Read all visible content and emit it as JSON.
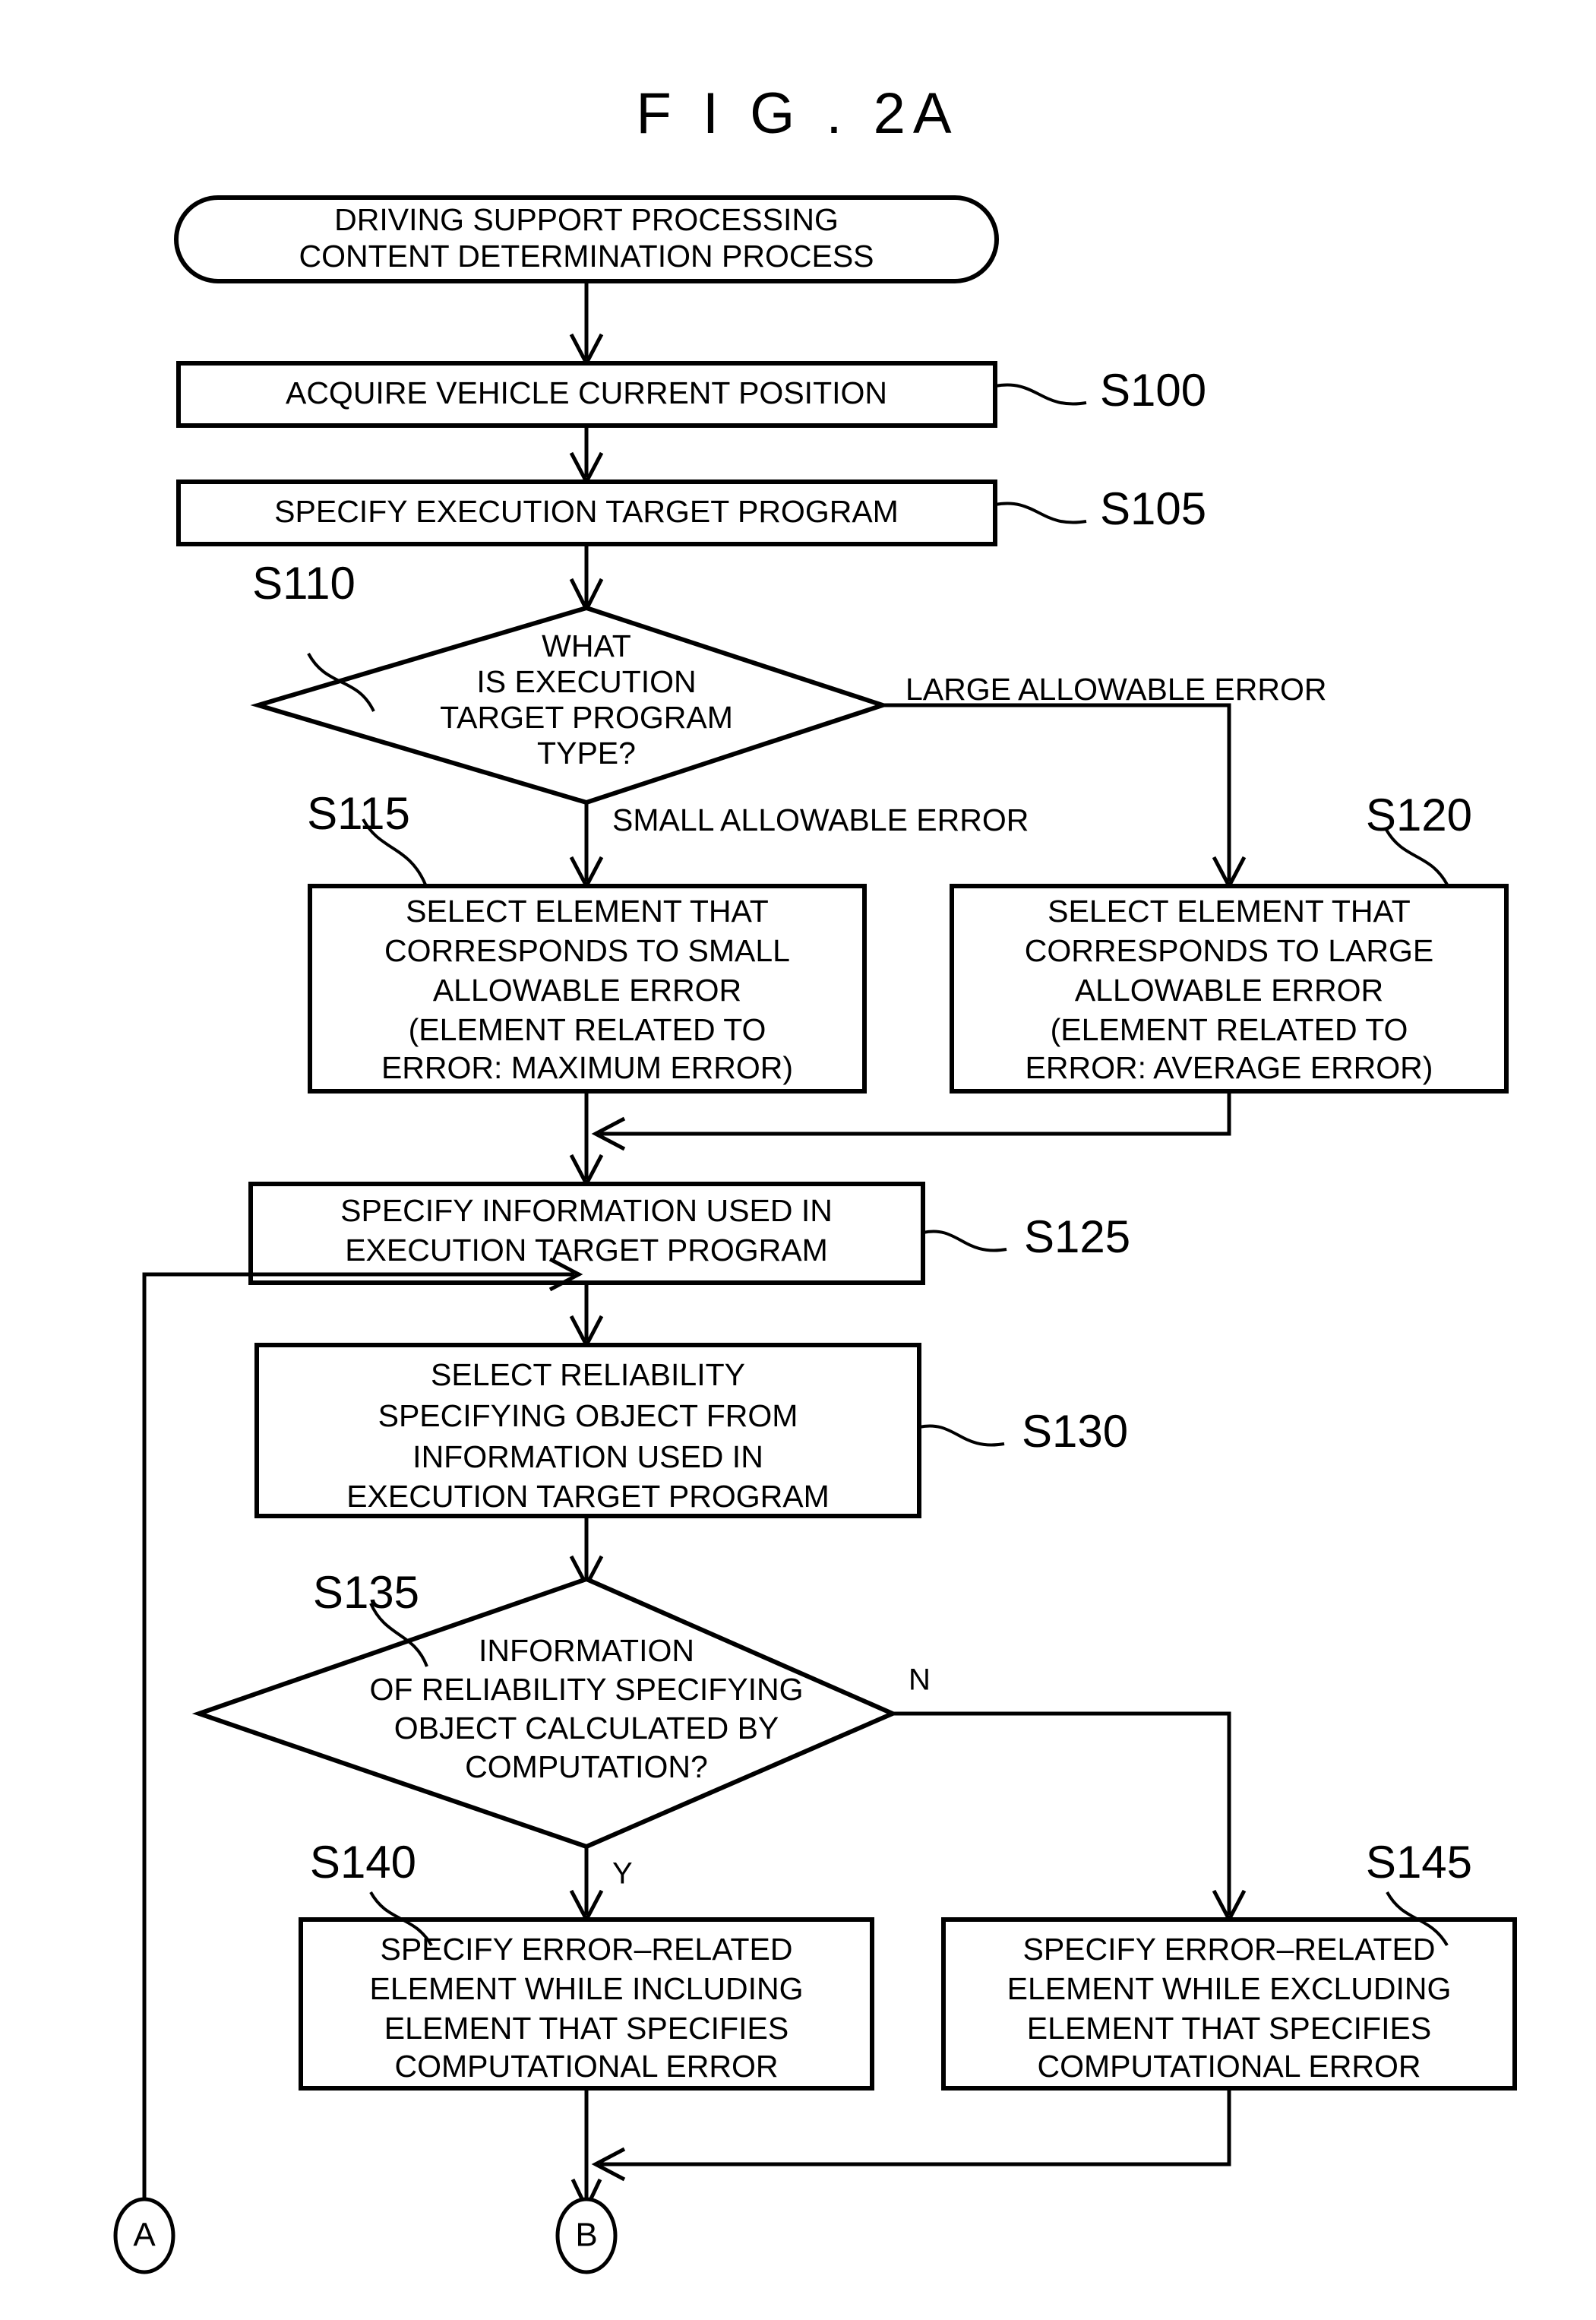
{
  "figure": {
    "title": "F I G . 2A"
  },
  "nodes": {
    "start": {
      "id": "start-terminal",
      "lines": [
        "DRIVING SUPPORT PROCESSING",
        "CONTENT DETERMINATION PROCESS"
      ]
    },
    "s100": {
      "step": "S100",
      "lines": [
        "ACQUIRE VEHICLE CURRENT POSITION"
      ]
    },
    "s105": {
      "step": "S105",
      "lines": [
        "SPECIFY EXECUTION TARGET PROGRAM"
      ]
    },
    "s110": {
      "step": "S110",
      "lines": [
        "WHAT",
        "IS EXECUTION",
        "TARGET PROGRAM",
        "TYPE?"
      ]
    },
    "s115": {
      "step": "S115",
      "lines": [
        "SELECT ELEMENT THAT",
        "CORRESPONDS TO SMALL",
        "ALLOWABLE ERROR",
        "(ELEMENT RELATED TO",
        "ERROR: MAXIMUM ERROR)"
      ]
    },
    "s120": {
      "step": "S120",
      "lines": [
        "SELECT ELEMENT THAT",
        "CORRESPONDS TO LARGE",
        "ALLOWABLE ERROR",
        "(ELEMENT RELATED TO",
        "ERROR: AVERAGE ERROR)"
      ]
    },
    "s125": {
      "step": "S125",
      "lines": [
        "SPECIFY INFORMATION USED IN",
        "EXECUTION TARGET PROGRAM"
      ]
    },
    "s130": {
      "step": "S130",
      "lines": [
        "SELECT RELIABILITY",
        "SPECIFYING OBJECT FROM",
        "INFORMATION USED IN",
        "EXECUTION TARGET PROGRAM"
      ]
    },
    "s135": {
      "step": "S135",
      "lines": [
        "INFORMATION",
        "OF RELIABILITY SPECIFYING",
        "OBJECT CALCULATED BY",
        "COMPUTATION?"
      ]
    },
    "s140": {
      "step": "S140",
      "lines": [
        "SPECIFY ERROR–RELATED",
        "ELEMENT WHILE INCLUDING",
        "ELEMENT THAT SPECIFIES",
        "COMPUTATIONAL ERROR"
      ]
    },
    "s145": {
      "step": "S145",
      "lines": [
        "SPECIFY ERROR–RELATED",
        "ELEMENT WHILE EXCLUDING",
        "ELEMENT THAT SPECIFIES",
        "COMPUTATIONAL ERROR"
      ]
    }
  },
  "branch_labels": {
    "large_allowable_error": "LARGE ALLOWABLE ERROR",
    "small_allowable_error": "SMALL ALLOWABLE ERROR",
    "no": "N",
    "yes": "Y"
  },
  "connectors": {
    "a": "A",
    "b": "B"
  },
  "colors": {
    "ink": "#000000",
    "paper": "#ffffff"
  }
}
